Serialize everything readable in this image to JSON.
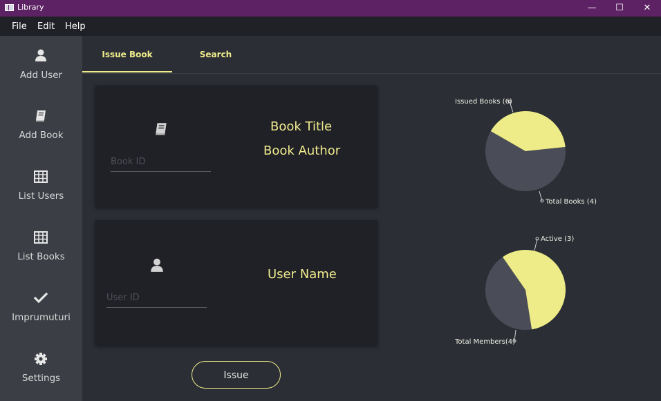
{
  "window": {
    "title": "Library",
    "minimize": "—",
    "maximize": "☐",
    "close": "✕"
  },
  "menu": [
    "File",
    "Edit",
    "Help"
  ],
  "sidebar": {
    "items": [
      {
        "label": "Add User",
        "icon": "user-icon"
      },
      {
        "label": "Add Book",
        "icon": "book-icon"
      },
      {
        "label": "List Users",
        "icon": "table-icon"
      },
      {
        "label": "List Books",
        "icon": "table-icon"
      },
      {
        "label": "Imprumuturi",
        "icon": "check-icon"
      },
      {
        "label": "Settings",
        "icon": "gear-icon"
      }
    ]
  },
  "tabs": [
    {
      "label": "Issue Book",
      "active": true
    },
    {
      "label": "Search",
      "active": false
    }
  ],
  "book_card": {
    "id_placeholder": "Book ID",
    "title": "Book Title",
    "author": "Book Author"
  },
  "user_card": {
    "id_placeholder": "User ID",
    "name": "User Name"
  },
  "issue_button": "Issue",
  "colors": {
    "accent": "#f0ec8d",
    "pie_dark": "#4a4d57",
    "pie_light": "#eeec88",
    "titlebar": "#5c2263"
  },
  "chart_data": [
    {
      "type": "pie",
      "slices": [
        {
          "label": "Issued Books (6)",
          "value": 6
        },
        {
          "label": "Total Books (4)",
          "value": 4
        }
      ]
    },
    {
      "type": "pie",
      "slices": [
        {
          "label": "Active (3)",
          "value": 3
        },
        {
          "label": "Total Members(4)",
          "value": 4
        }
      ]
    }
  ]
}
